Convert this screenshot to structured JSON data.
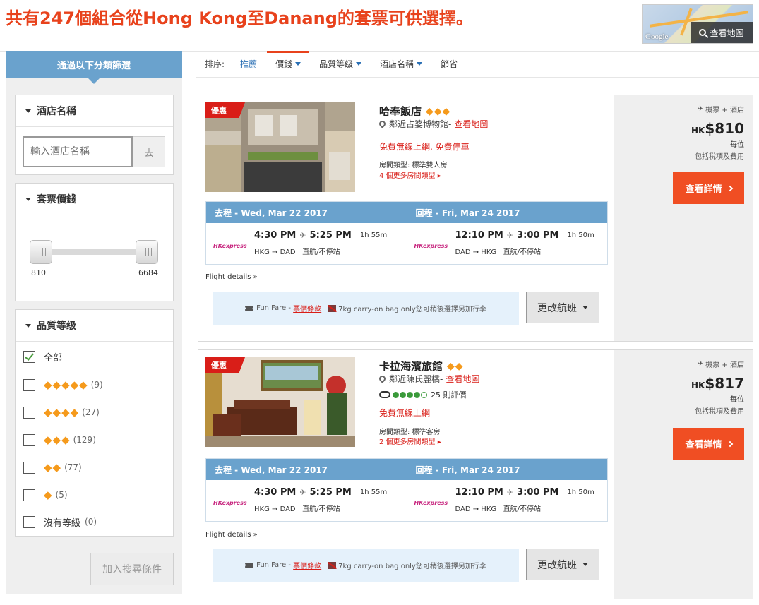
{
  "header": {
    "result_title": "共有247個組合從Hong Kong至Danang的套票可供選擇。",
    "map_logo": "Google",
    "map_button": "查看地圖"
  },
  "sidebar": {
    "title": "通過以下分類篩選",
    "hotel_name": {
      "title": "酒店名稱",
      "placeholder": "輸入酒店名稱",
      "go": "去"
    },
    "price": {
      "title": "套票價錢",
      "min": "810",
      "max": "6684"
    },
    "rating": {
      "title": "品質等级",
      "options": [
        {
          "label": "全部",
          "diamonds": "",
          "count": "",
          "checked": true
        },
        {
          "label": "",
          "diamonds": "◆◆◆◆◆",
          "count": "(9)",
          "checked": false
        },
        {
          "label": "",
          "diamonds": "◆◆◆◆",
          "count": "(27)",
          "checked": false
        },
        {
          "label": "",
          "diamonds": "◆◆◆",
          "count": "(129)",
          "checked": false
        },
        {
          "label": "",
          "diamonds": "◆◆",
          "count": "(77)",
          "checked": false
        },
        {
          "label": "",
          "diamonds": "◆",
          "count": "(5)",
          "checked": false
        },
        {
          "label": "沒有等級",
          "diamonds": "",
          "count": "(0)",
          "checked": false
        }
      ]
    },
    "add_button": "加入搜尋條件"
  },
  "sortbar": {
    "label": "排序:",
    "items": [
      "推薦",
      "價錢",
      "品質等级",
      "酒店名稱",
      "節省"
    ]
  },
  "colors": {
    "accent": "#e8421c",
    "header_blue": "#6aa2cd",
    "cta": "#f04e23",
    "diamond": "#f59a1c"
  },
  "cards": [
    {
      "badge": "優惠",
      "name": "哈奉飯店",
      "diamonds": "◆◆◆",
      "location": "鄰近占婆博物館",
      "map_link": "查看地圖",
      "amenities": "免費無線上網, 免費停車",
      "room_type": "房間類型: 標準雙人房",
      "more_rooms": "4 個更多房間類型 ▸",
      "package": "機票 + 酒店",
      "currency": "HK",
      "price": "$810",
      "per": "每位",
      "tax": "包括稅項及費用",
      "detail_button": "查看詳情",
      "outbound_head": "去程 - Wed, Mar 22 2017",
      "return_head": "回程 - Fri, Mar 24 2017",
      "airline": "HKexpress",
      "outbound": {
        "dep": "4:30 PM",
        "arr": "5:25 PM",
        "dur": "1h 55m",
        "route": "HKG → DAD",
        "stops": "直航/不停站"
      },
      "return": {
        "dep": "12:10 PM",
        "arr": "3:00 PM",
        "dur": "1h 50m",
        "route": "DAD → HKG",
        "stops": "直航/不停站"
      },
      "flight_details": "Flight details »",
      "fare_name": "Fun Fare -",
      "fare_terms": "票價條款",
      "bag_note": "7kg carry-on bag only您可稍後選擇另加行李",
      "change_button": "更改航班"
    },
    {
      "badge": "優惠",
      "name": "卡拉海濱旅館",
      "diamonds": "◆◆",
      "location": "鄰近陳氏麗橋",
      "map_link": "查看地圖",
      "reviews": "25 則評價",
      "amenities": "免費無線上網",
      "room_type": "房間類型: 標準客房",
      "more_rooms": "2 個更多房間類型 ▸",
      "package": "機票 + 酒店",
      "currency": "HK",
      "price": "$817",
      "per": "每位",
      "tax": "包括稅項及費用",
      "detail_button": "查看詳情",
      "outbound_head": "去程 - Wed, Mar 22 2017",
      "return_head": "回程 - Fri, Mar 24 2017",
      "airline": "HKexpress",
      "outbound": {
        "dep": "4:30 PM",
        "arr": "5:25 PM",
        "dur": "1h 55m",
        "route": "HKG → DAD",
        "stops": "直航/不停站"
      },
      "return": {
        "dep": "12:10 PM",
        "arr": "3:00 PM",
        "dur": "1h 50m",
        "route": "DAD → HKG",
        "stops": "直航/不停站"
      },
      "flight_details": "Flight details »",
      "fare_name": "Fun Fare -",
      "fare_terms": "票價條款",
      "bag_note": "7kg carry-on bag only您可稍後選擇另加行李",
      "change_button": "更改航班"
    }
  ]
}
